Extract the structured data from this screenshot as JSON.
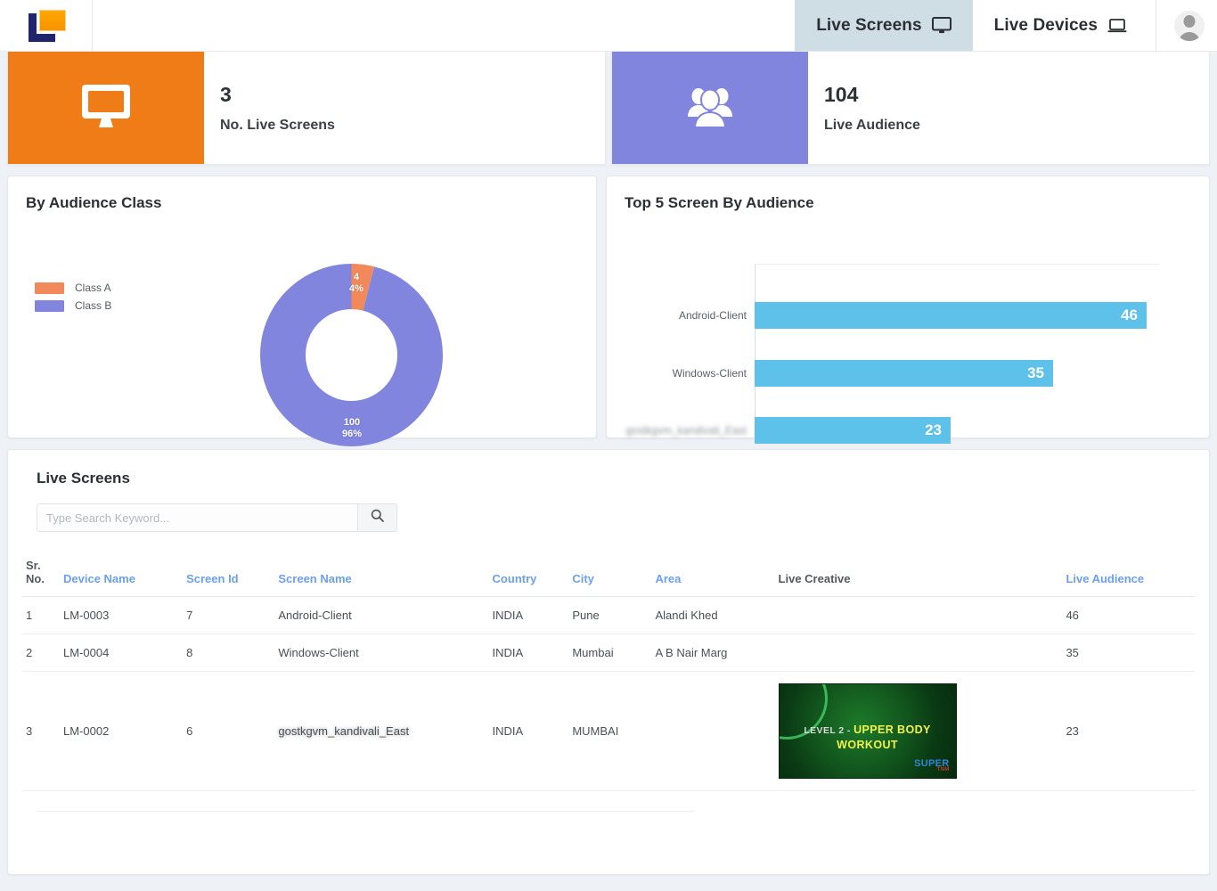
{
  "header": {
    "logo_name": "lm-logo",
    "nav": [
      {
        "label": "Live Screens",
        "icon": "desktop-icon",
        "active": true
      },
      {
        "label": "Live Devices",
        "icon": "laptop-icon",
        "active": false
      }
    ],
    "avatar_alt": "user-avatar"
  },
  "stats": [
    {
      "value": "3",
      "label": "No. Live Screens",
      "icon": "desktop-icon",
      "color": "#f07c17"
    },
    {
      "value": "104",
      "label": "Live Audience",
      "icon": "users-icon",
      "color": "#8185dd"
    }
  ],
  "panels": {
    "audience_class_title": "By Audience Class",
    "top5_title": "Top 5 Screen By Audience"
  },
  "chart_data": [
    {
      "type": "pie",
      "title": "By Audience Class",
      "variant": "donut",
      "legend_position": "left",
      "labels": [
        "Class A",
        "Class B"
      ],
      "values": [
        4,
        100
      ],
      "percents": [
        "4%",
        "96%"
      ],
      "value_labels": [
        "4",
        "100"
      ],
      "colors": [
        "#f2895a",
        "#8185dd"
      ],
      "total": 104
    },
    {
      "type": "bar",
      "orientation": "horizontal",
      "title": "Top 5 Screen By Audience",
      "categories": [
        "Android-Client",
        "Windows-Client",
        "gostkgvm_kandivali_East"
      ],
      "category_redacted": [
        false,
        false,
        true
      ],
      "values": [
        46,
        35,
        23
      ],
      "value_labels": [
        "46",
        "35",
        "23"
      ],
      "color": "#5ec1ea",
      "xlabel": "",
      "ylabel": "",
      "xlim": [
        0,
        50
      ],
      "grid": false
    }
  ],
  "table": {
    "title": "Live Screens",
    "search": {
      "placeholder": "Type Search Keyword...",
      "value": "",
      "button_icon": "search-icon"
    },
    "columns": [
      {
        "label": "Sr. No.",
        "sortable": false
      },
      {
        "label": "Device Name",
        "sortable": true
      },
      {
        "label": "Screen Id",
        "sortable": true
      },
      {
        "label": "Screen Name",
        "sortable": true
      },
      {
        "label": "Country",
        "sortable": true
      },
      {
        "label": "City",
        "sortable": true
      },
      {
        "label": "Area",
        "sortable": true
      },
      {
        "label": "Live Creative",
        "sortable": false
      },
      {
        "label": "Live Audience",
        "sortable": true
      }
    ],
    "rows": [
      {
        "sr": "1",
        "device": "LM-0003",
        "screen_id": "7",
        "screen_name": "Android-Client",
        "screen_name_redacted": false,
        "country": "INDIA",
        "city": "Pune",
        "area": "Alandi Khed",
        "creative": null,
        "audience": "46"
      },
      {
        "sr": "2",
        "device": "LM-0004",
        "screen_id": "8",
        "screen_name": "Windows-Client",
        "screen_name_redacted": false,
        "country": "INDIA",
        "city": "Mumbai",
        "area": "A B Nair Marg",
        "creative": null,
        "audience": "35"
      },
      {
        "sr": "3",
        "device": "LM-0002",
        "screen_id": "6",
        "screen_name": "gostkgvm_kandivali_East",
        "screen_name_redacted": true,
        "country": "INDIA",
        "city": "MUMBAI",
        "area": "",
        "creative": {
          "line1_prefix": "LEVEL 2 - ",
          "line1": "UPPER BODY",
          "line2": "WORKOUT",
          "logo": "SUPER",
          "logo_sub": "TNM"
        },
        "audience": "23"
      }
    ]
  }
}
